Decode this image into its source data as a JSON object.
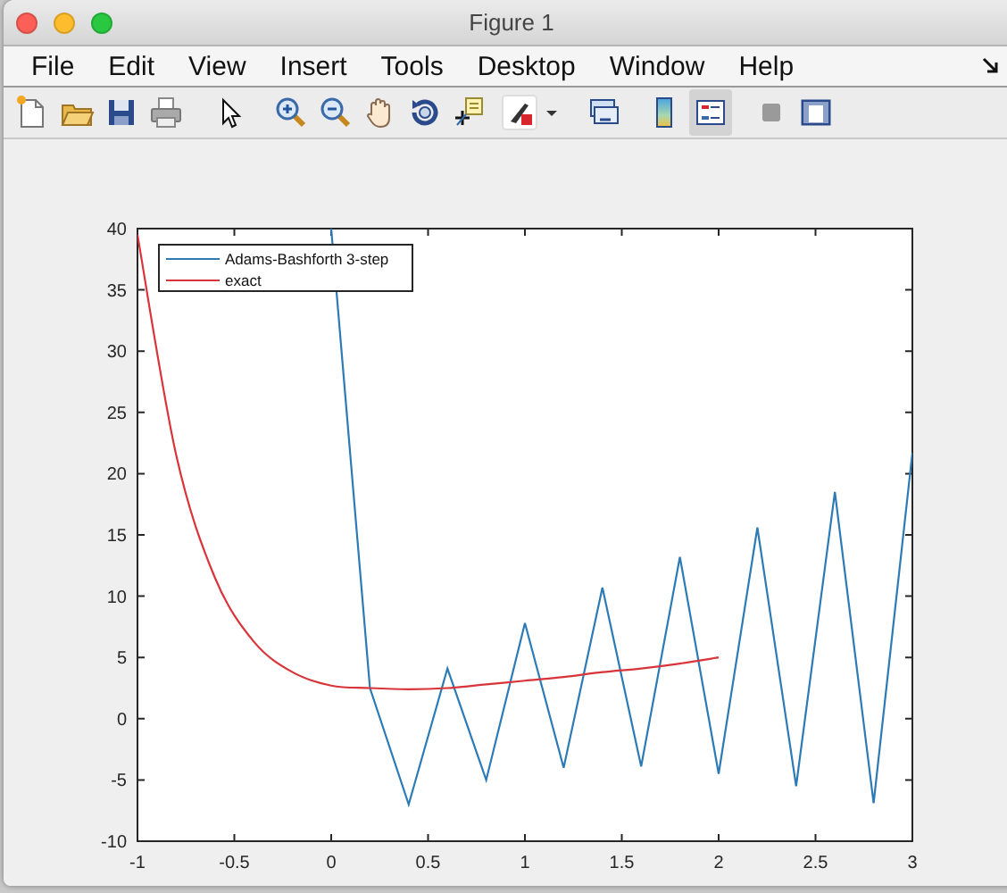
{
  "window": {
    "title": "Figure 1"
  },
  "menu": [
    "File",
    "Edit",
    "View",
    "Insert",
    "Tools",
    "Desktop",
    "Window",
    "Help"
  ],
  "toolbar": [
    {
      "kind": "new",
      "selected": false
    },
    {
      "kind": "open",
      "selected": false
    },
    {
      "kind": "save",
      "selected": false
    },
    {
      "kind": "print",
      "selected": false
    },
    {
      "kind": "pointer",
      "selected": false
    },
    {
      "kind": "zoom-in",
      "selected": false
    },
    {
      "kind": "zoom-out",
      "selected": false
    },
    {
      "kind": "pan",
      "selected": false
    },
    {
      "kind": "rotate",
      "selected": false
    },
    {
      "kind": "data-cursor",
      "selected": false
    },
    {
      "kind": "brush",
      "selected": false
    },
    {
      "kind": "caret",
      "selected": false
    },
    {
      "kind": "link",
      "selected": false
    },
    {
      "kind": "colorbar",
      "selected": false
    },
    {
      "kind": "legend",
      "selected": true
    },
    {
      "kind": "hide-tools",
      "selected": false
    },
    {
      "kind": "show-tools",
      "selected": false
    }
  ],
  "figure": {
    "chart_data": {
      "type": "line",
      "x": [
        -1,
        -0.8,
        -0.6,
        -0.4,
        -0.2,
        0,
        0.2,
        0.4,
        0.6,
        0.8,
        1,
        1.2,
        1.4,
        1.6,
        1.8,
        2,
        2.2,
        2.4,
        2.6,
        2.8,
        3
      ],
      "series": [
        {
          "name": "Adams-Bashforth 3-step",
          "color": "#2c7bb6",
          "values": [
            null,
            null,
            null,
            null,
            null,
            40,
            2.5,
            -7,
            4.1,
            -5,
            7.8,
            -4,
            10.7,
            -3.9,
            13.2,
            -4.5,
            15.6,
            -5.5,
            18.5,
            -6.9,
            21.7
          ]
        },
        {
          "name": "exact",
          "color": "#d9343a",
          "values": [
            39.5,
            21.5,
            11.5,
            6.3,
            3.8,
            2.7,
            2.5,
            2.4,
            2.5,
            2.8,
            3.1,
            3.4,
            3.8,
            4.1,
            4.5,
            5,
            null,
            null,
            null,
            null,
            null
          ]
        }
      ],
      "xlim": [
        -1,
        3
      ],
      "ylim": [
        -10,
        40
      ],
      "xticks": [
        -1,
        -0.5,
        0,
        0.5,
        1,
        1.5,
        2,
        2.5,
        3
      ],
      "yticks": [
        -10,
        -5,
        0,
        5,
        10,
        15,
        20,
        25,
        30,
        35,
        40
      ],
      "legend": true
    }
  }
}
